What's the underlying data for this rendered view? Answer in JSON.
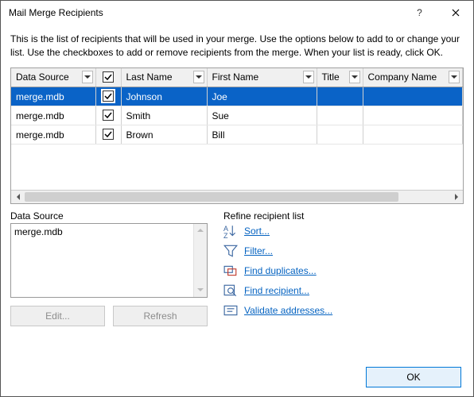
{
  "window": {
    "title": "Mail Merge Recipients"
  },
  "instructions": "This is the list of recipients that will be used in your merge.  Use the options below to add to or change your list.  Use the checkboxes to add or remove recipients from the merge.  When your list is ready, click OK.",
  "grid": {
    "columns": {
      "data_source": "Data Source",
      "last_name": "Last Name",
      "first_name": "First Name",
      "title": "Title",
      "company_name": "Company Name"
    },
    "rows": [
      {
        "data_source": "merge.mdb",
        "checked": true,
        "last_name": "Johnson",
        "first_name": "Joe",
        "title": "",
        "company_name": "",
        "selected": true
      },
      {
        "data_source": "merge.mdb",
        "checked": true,
        "last_name": "Smith",
        "first_name": "Sue",
        "title": "",
        "company_name": "",
        "selected": false
      },
      {
        "data_source": "merge.mdb",
        "checked": true,
        "last_name": "Brown",
        "first_name": "Bill",
        "title": "",
        "company_name": "",
        "selected": false
      }
    ]
  },
  "data_source_section": {
    "label": "Data Source",
    "items": [
      "merge.mdb"
    ],
    "edit_label": "Edit...",
    "refresh_label": "Refresh"
  },
  "refine_section": {
    "label": "Refine recipient list",
    "sort": "Sort...",
    "filter": "Filter...",
    "find_duplicates": "Find duplicates...",
    "find_recipient": "Find recipient...",
    "validate": "Validate addresses..."
  },
  "footer": {
    "ok_label": "OK"
  }
}
